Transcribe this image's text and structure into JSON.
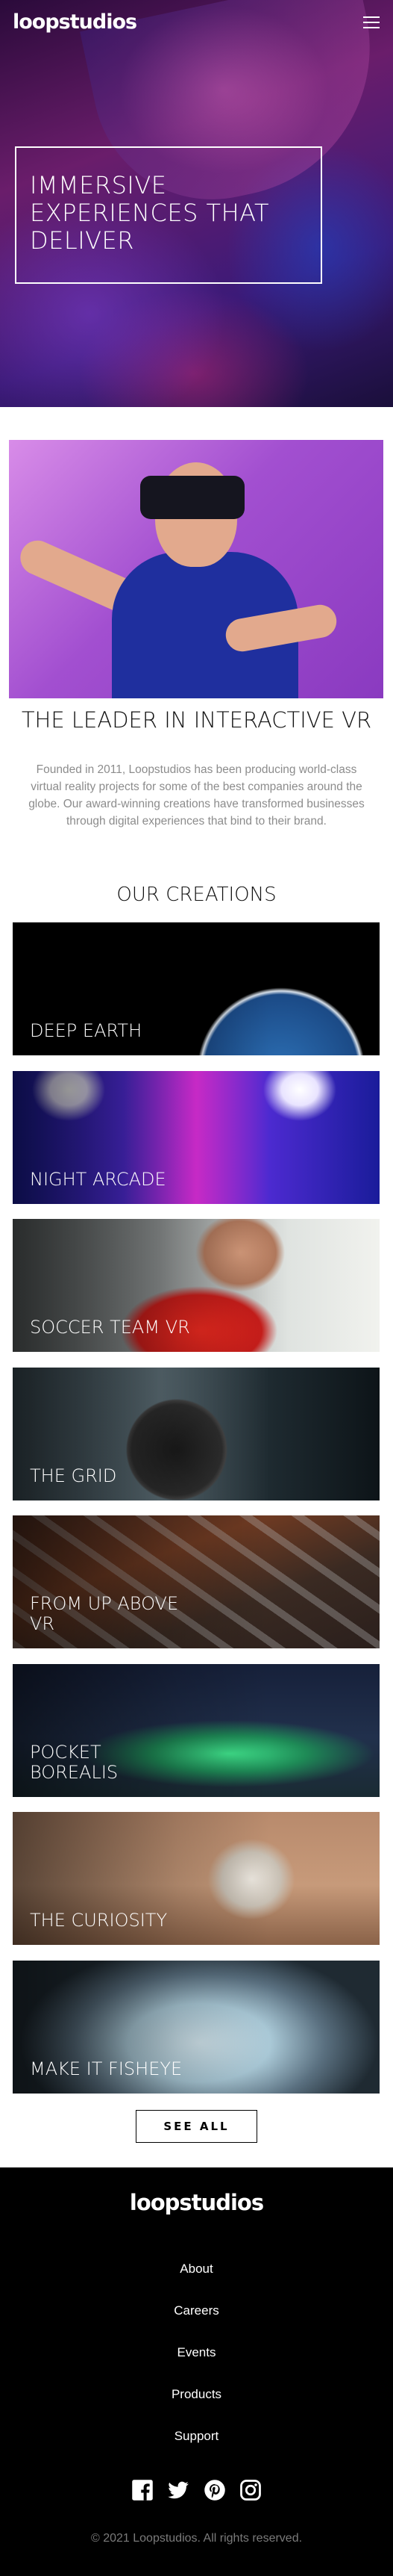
{
  "header": {
    "logo": "loopstudios",
    "menu_icon": "hamburger-menu-icon"
  },
  "hero": {
    "headline": "Immersive experiences that deliver"
  },
  "intro": {
    "title": "The leader in interactive VR",
    "text": "Founded in 2011, Loopstudios has been producing world-class virtual reality projects for some of the best companies around the globe. Our award-winning creations have transformed businesses through digital experiences that bind to their brand."
  },
  "creations": {
    "title": "Our creations",
    "items": [
      {
        "label": "Deep earth"
      },
      {
        "label": "Night arcade"
      },
      {
        "label": "Soccer team VR"
      },
      {
        "label": "The grid"
      },
      {
        "label": "From up above VR"
      },
      {
        "label": "Pocket borealis"
      },
      {
        "label": "The curiosity"
      },
      {
        "label": "Make it fisheye"
      }
    ],
    "see_all": "See all"
  },
  "footer": {
    "logo": "loopstudios",
    "nav": [
      "About",
      "Careers",
      "Events",
      "Products",
      "Support"
    ],
    "social_icons": [
      "facebook-icon",
      "twitter-icon",
      "pinterest-icon",
      "instagram-icon"
    ],
    "copyright": "© 2021 Loopstudios. All rights reserved."
  },
  "colors": {
    "footer_bg": "#000000",
    "text_muted": "#8c8c8c",
    "hero_tint": "#6a1d6b"
  }
}
